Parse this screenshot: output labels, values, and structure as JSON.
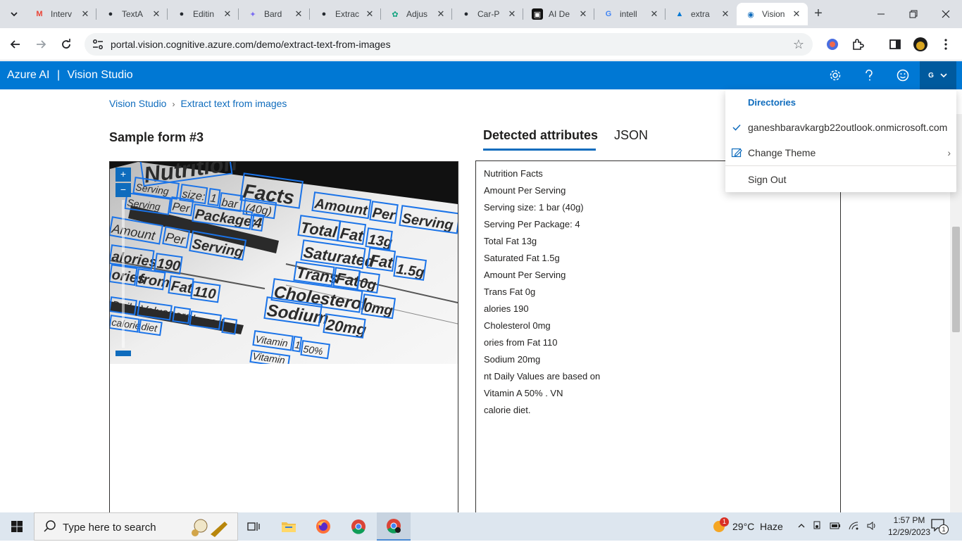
{
  "browser": {
    "tabs": [
      {
        "label": "Interv",
        "icon": "gmail-icon",
        "fav_text": "M",
        "fav_color": "#ea4335",
        "fav_bg": "transparent"
      },
      {
        "label": "TextA",
        "icon": "github-icon",
        "fav_text": "●",
        "fav_color": "#24292f",
        "fav_bg": "transparent"
      },
      {
        "label": "Editin",
        "icon": "github-icon",
        "fav_text": "●",
        "fav_color": "#24292f",
        "fav_bg": "transparent"
      },
      {
        "label": "Bard",
        "icon": "bard-sparkle-icon",
        "fav_text": "✦",
        "fav_color": "#7a6cf2",
        "fav_bg": "transparent"
      },
      {
        "label": "Extrac",
        "icon": "github-icon",
        "fav_text": "●",
        "fav_color": "#24292f",
        "fav_bg": "transparent"
      },
      {
        "label": "Adjus",
        "icon": "openai-icon",
        "fav_text": "✿",
        "fav_color": "#10a37f",
        "fav_bg": "transparent"
      },
      {
        "label": "Car-P",
        "icon": "github-icon",
        "fav_text": "●",
        "fav_color": "#24292f",
        "fav_bg": "transparent"
      },
      {
        "label": "AI De",
        "icon": "nvidia-icon",
        "fav_text": "▣",
        "fav_color": "#ffffff",
        "fav_bg": "#111111"
      },
      {
        "label": "intell",
        "icon": "google-icon",
        "fav_text": "G",
        "fav_color": "#4285f4",
        "fav_bg": "transparent"
      },
      {
        "label": "extra",
        "icon": "azure-icon",
        "fav_text": "▲",
        "fav_color": "#0078d4",
        "fav_bg": "transparent"
      },
      {
        "label": "Vision",
        "icon": "vision-studio-icon",
        "fav_text": "◉",
        "fav_color": "#0f6cbd",
        "fav_bg": "transparent"
      }
    ],
    "new_tab": "+",
    "url": "portal.vision.cognitive.azure.com/demo/extract-text-from-images"
  },
  "app": {
    "brand": "Azure AI",
    "separator": "|",
    "product": "Vision Studio",
    "account_initial": "G"
  },
  "breadcrumb": {
    "root": "Vision Studio",
    "current": "Extract text from images"
  },
  "sample_title": "Sample form #3",
  "result_tabs": {
    "detected": "Detected attributes",
    "json": "JSON"
  },
  "detected_lines": [
    "Nutrition Facts",
    "Amount Per Serving",
    "Serving size: 1 bar (40g)",
    "Serving Per Package: 4",
    "Total Fat 13g",
    "Saturated Fat 1.5g",
    "Amount Per Serving",
    "Trans Fat 0g",
    "alories 190",
    "Cholesterol 0mg",
    "ories from Fat 110",
    "Sodium 20mg",
    "nt Daily Values are based on",
    "Vitamin A 50% . VN",
    "calorie diet."
  ],
  "image_words": {
    "nutrition": "Nutrition",
    "facts": "Facts",
    "serving": "Serving",
    "size": "size:",
    "one": "1",
    "bar": "bar",
    "forty_g": "(40g)",
    "serving2": "Serving",
    "per": "Per",
    "package": "Package:",
    "four": "4",
    "amount": "Amount",
    "per2": "Per",
    "serving3": "Serving",
    "amount2": "Amount",
    "per3": "Per",
    "serving4": "Serving",
    "total": "Total",
    "fat": "Fat",
    "thirteen_g": "13g",
    "alories": "alories",
    "n190": "190",
    "saturated": "Saturated",
    "fat2": "Fat",
    "one_five_g": "1.5g",
    "ories": "ories",
    "from": "from",
    "fat3": "Fat",
    "n110": "110",
    "trans": "Trans",
    "fat4": "Fat",
    "zero_g": "0g",
    "cholesterol": "Cholesterol",
    "zero_mg": "0mg",
    "daily": "Daily",
    "values": "Values",
    "are": "are",
    "based": "based",
    "on": "on",
    "sodium": "Sodium",
    "twenty_mg": "20mg",
    "calorie": "calorie",
    "diet": "diet",
    "vitamin": "Vitamin",
    "i1": "1",
    "pct": "50%",
    "vitamin2": "Vitamin"
  },
  "account_menu": {
    "header": "Directories",
    "directory": "ganeshbaravkargb22outlook.onmicrosoft.com",
    "change_theme": "Change Theme",
    "sign_out": "Sign Out"
  },
  "taskbar": {
    "search_placeholder": "Type here to search",
    "weather": "29°C  Haze",
    "weather_badge": "1",
    "time": "1:57 PM",
    "date": "12/29/2023",
    "notifications": "1"
  },
  "colors": {
    "azure_blue": "#0078d4",
    "link_blue": "#0f6cbd",
    "box_blue": "#1a73e8"
  }
}
